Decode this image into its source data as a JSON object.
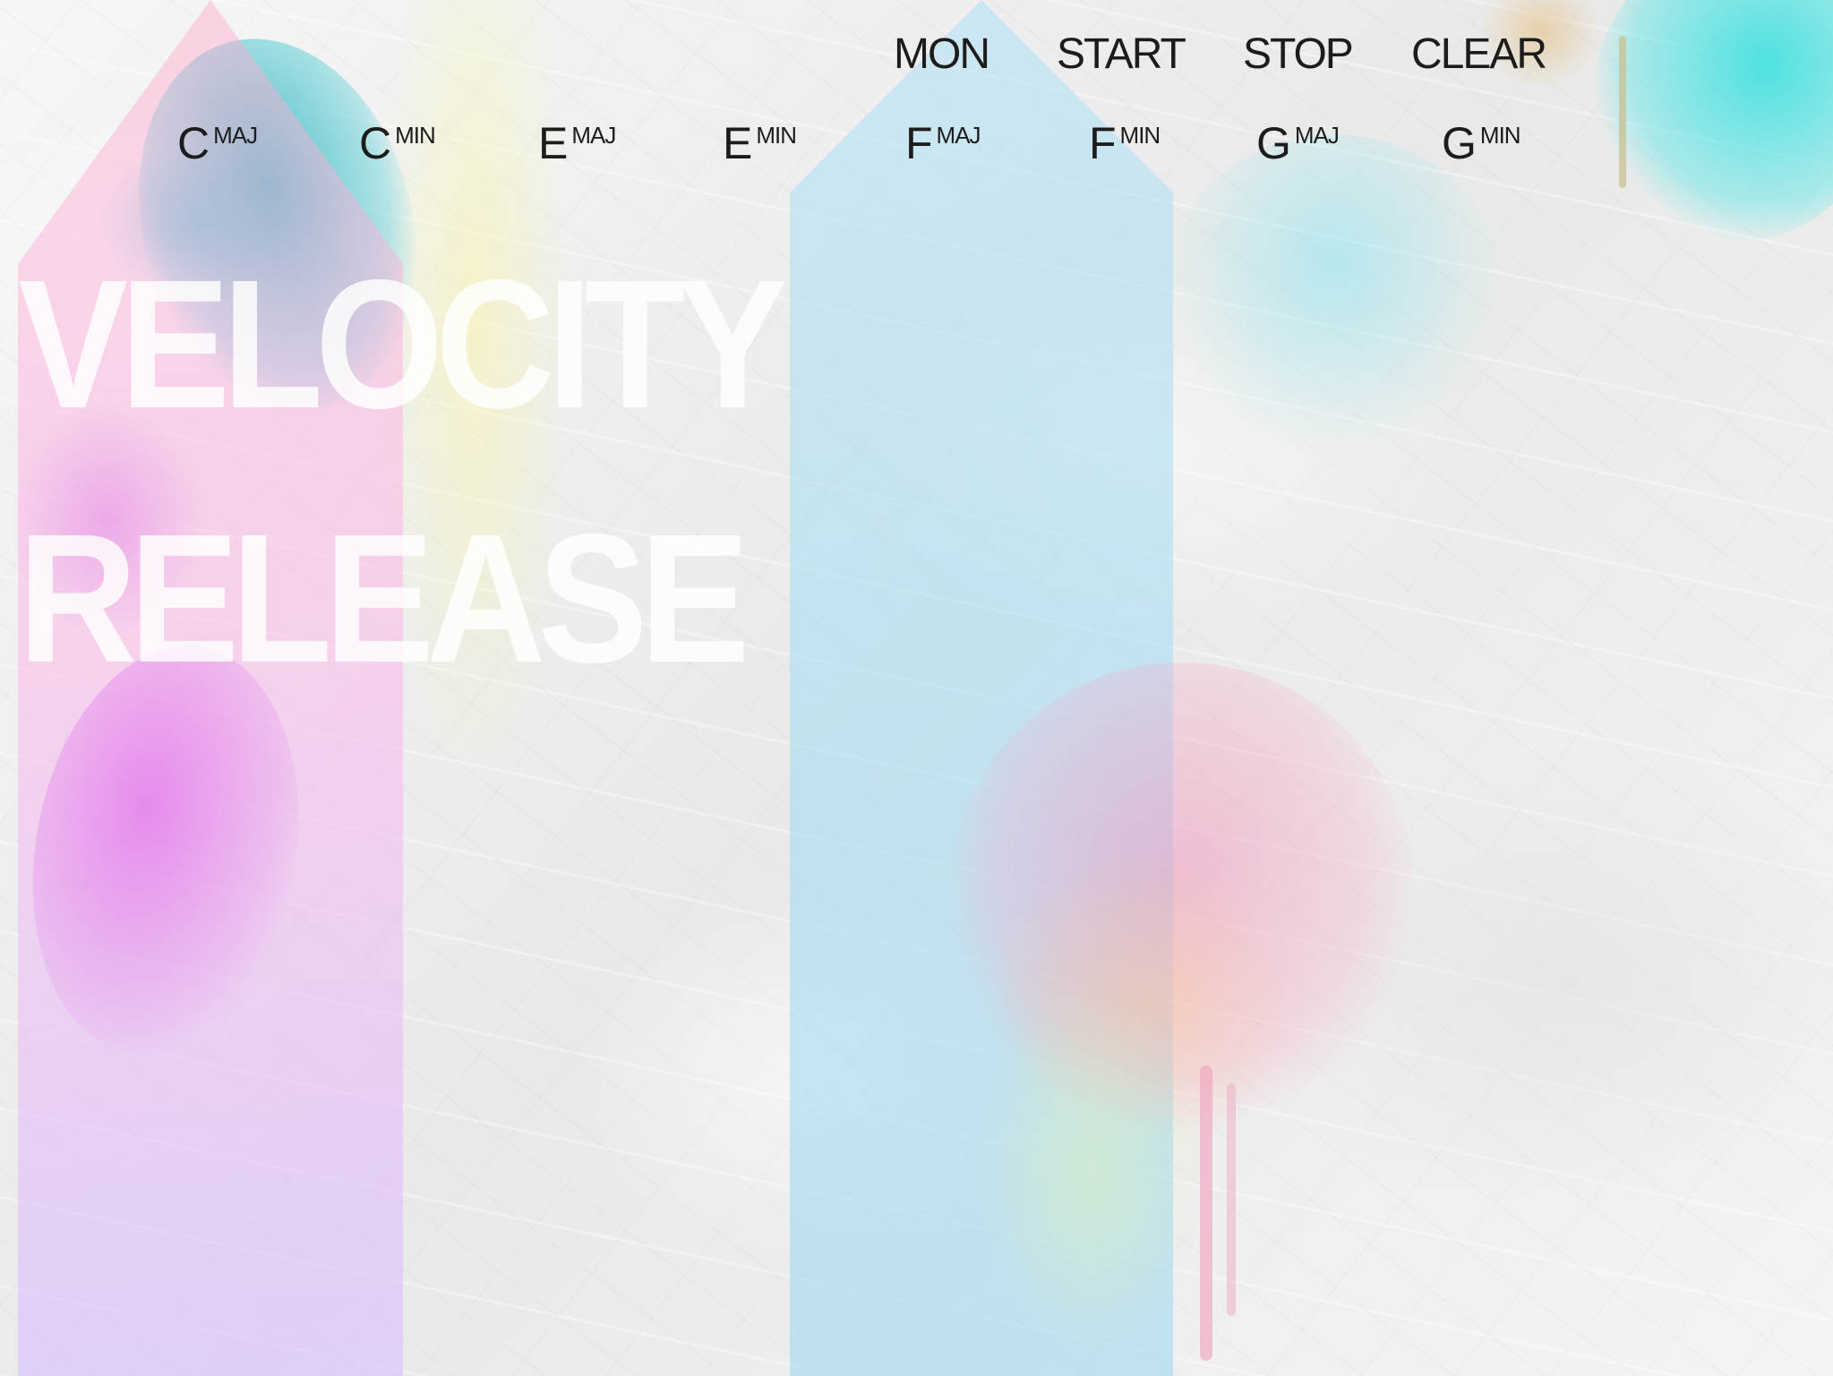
{
  "controls": {
    "mon": "MON",
    "start": "START",
    "stop": "STOP",
    "clear": "CLEAR"
  },
  "chords": [
    {
      "root": "C",
      "quality": "MAJ"
    },
    {
      "root": "C",
      "quality": "MIN"
    },
    {
      "root": "E",
      "quality": "MAJ"
    },
    {
      "root": "E",
      "quality": "MIN"
    },
    {
      "root": "F",
      "quality": "MAJ"
    },
    {
      "root": "F",
      "quality": "MIN"
    },
    {
      "root": "G",
      "quality": "MAJ"
    },
    {
      "root": "G",
      "quality": "MIN"
    }
  ],
  "labels": {
    "velocity": "VELOCITY",
    "release": "RELEASE"
  },
  "colors": {
    "text": "#1c1c1c",
    "pink_column": "#f5b4e6",
    "blue_column": "#aee0f2",
    "teal_splash": "#2ab4be",
    "cyan_splash": "#46e1e1",
    "magenta_splash": "#e16eeb",
    "label_fill": "#ffffff"
  }
}
